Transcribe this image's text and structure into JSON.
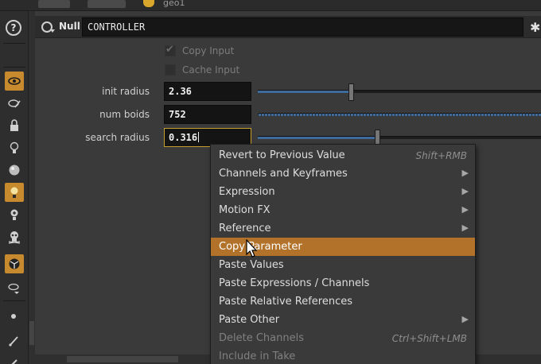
{
  "path": {
    "node_label": "geo1"
  },
  "header": {
    "node_type": "Null",
    "node_name": "CONTROLLER",
    "help_symbol": "?"
  },
  "checkboxes": [
    {
      "label": "Copy Input",
      "checked": true,
      "enabled": false
    },
    {
      "label": "Cache Input",
      "checked": false,
      "enabled": false
    }
  ],
  "params": [
    {
      "label": "init radius",
      "value": "2.36",
      "slider_fraction": 0.33,
      "slider_style": "plain"
    },
    {
      "label": "num boids",
      "value": "752",
      "slider_fraction": 1.0,
      "slider_style": "ticked"
    },
    {
      "label": "search radius",
      "value": "0.316",
      "slider_fraction": 0.42,
      "slider_style": "plain",
      "focused": true
    }
  ],
  "context_menu": {
    "items": [
      {
        "label": "Revert to Previous Value",
        "shortcut": "Shift+RMB",
        "submenu": false,
        "enabled": true
      },
      {
        "label": "Channels and Keyframes",
        "submenu": true,
        "enabled": true
      },
      {
        "label": "Expression",
        "submenu": true,
        "enabled": true
      },
      {
        "label": "Motion FX",
        "submenu": true,
        "enabled": true
      },
      {
        "label": "Reference",
        "submenu": true,
        "enabled": true
      },
      {
        "label": "Copy Parameter",
        "submenu": false,
        "enabled": true,
        "highlighted": true
      },
      {
        "label": "Paste Values",
        "submenu": false,
        "enabled": true
      },
      {
        "label": "Paste Expressions / Channels",
        "submenu": false,
        "enabled": true
      },
      {
        "label": "Paste Relative References",
        "submenu": false,
        "enabled": true
      },
      {
        "label": "Paste Other",
        "submenu": true,
        "enabled": true
      },
      {
        "label": "Delete Channels",
        "shortcut": "Ctrl+Shift+LMB",
        "submenu": false,
        "enabled": false
      },
      {
        "label": "Include in Take",
        "submenu": false,
        "enabled": false
      }
    ]
  },
  "left_toolbar": {
    "tools": [
      {
        "icon": "eye-icon",
        "active": true
      },
      {
        "icon": "pencil-view-icon",
        "active": false
      },
      {
        "icon": "lock-icon",
        "active": false
      },
      {
        "icon": "bulb-outline-icon",
        "active": false
      },
      {
        "icon": "sphere-icon",
        "active": false
      },
      {
        "icon": "bulb-icon",
        "active": true
      },
      {
        "icon": "bulb-plus-icon",
        "active": false
      },
      {
        "icon": "skull-icon",
        "active": false
      },
      {
        "icon": "ball-icon",
        "active": true
      },
      {
        "icon": "eye-menu-icon",
        "active": false
      },
      {
        "icon": "dot-icon",
        "active": false
      },
      {
        "icon": "needle-icon",
        "active": false
      }
    ]
  },
  "colors": {
    "highlight": "#b3722a",
    "active_tool": "#c88a2e",
    "slider_fill": "#3e6a9c",
    "focus_border": "#c8a030"
  }
}
